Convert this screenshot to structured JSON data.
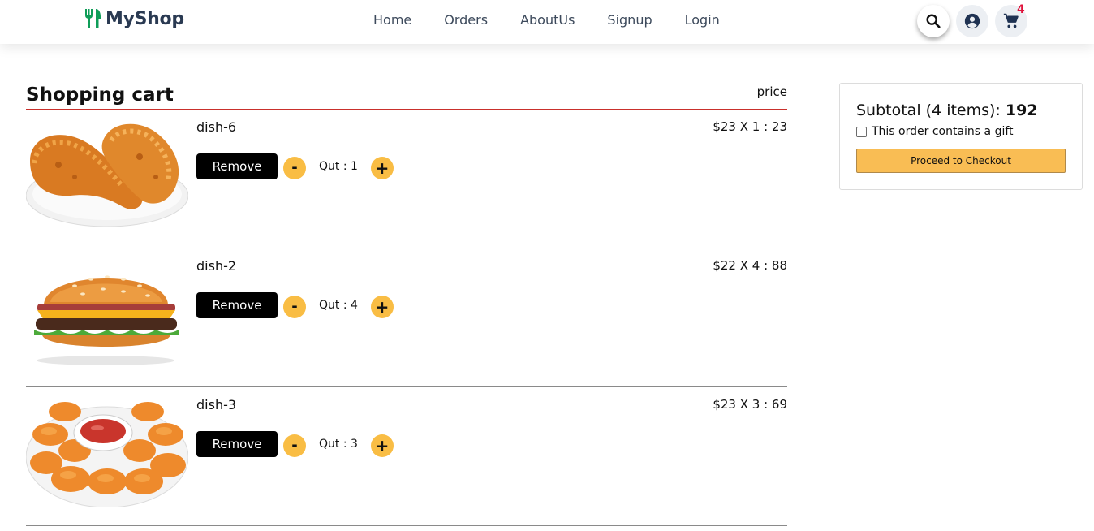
{
  "colors": {
    "accent_green": "#0f9d58",
    "brand_text": "#2a3a52",
    "qty_button": "#f9bd44",
    "remove_button": "#000000",
    "badge": "#e0123b",
    "checkout": "#f9bd54",
    "divider_red": "#c9302c"
  },
  "brand": {
    "name": "MyShop",
    "icon": "fork-knife-icon"
  },
  "nav": {
    "links": [
      "Home",
      "Orders",
      "AboutUs",
      "Signup",
      "Login"
    ]
  },
  "header_icons": {
    "search": "search-icon",
    "account": "account-circle-icon",
    "cart": "shopping-cart-icon",
    "cart_count": "4"
  },
  "cart": {
    "title": "Shopping cart",
    "price_label": "price",
    "items": [
      {
        "name": "dish-6",
        "price_text": "$23 X 1 : 23",
        "remove_label": "Remove",
        "minus_label": "-",
        "plus_label": "+",
        "qty_text": "Qut : 1",
        "image": "fried-chicken"
      },
      {
        "name": "dish-2",
        "price_text": "$22 X 4 : 88",
        "remove_label": "Remove",
        "minus_label": "-",
        "plus_label": "+",
        "qty_text": "Qut : 4",
        "image": "burger"
      },
      {
        "name": "dish-3",
        "price_text": "$23 X 3 : 69",
        "remove_label": "Remove",
        "minus_label": "-",
        "plus_label": "+",
        "qty_text": "Qut : 3",
        "image": "chicken-nuggets"
      }
    ]
  },
  "summary": {
    "subtotal_label": "Subtotal (4 items): ",
    "subtotal_value": "192",
    "gift_label": "This order contains a gift",
    "gift_checked": false,
    "checkout_label": "Proceed to Checkout"
  }
}
